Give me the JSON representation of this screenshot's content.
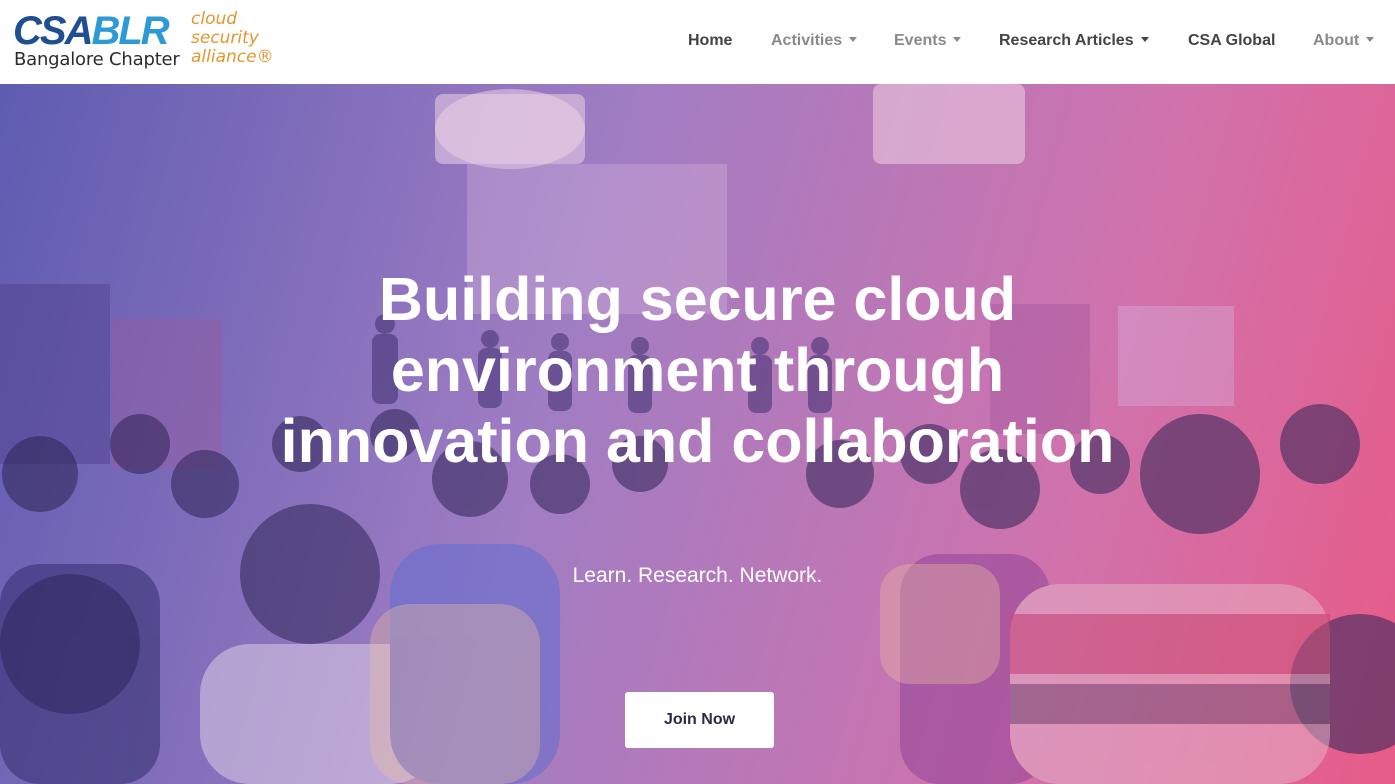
{
  "logo": {
    "csa": "CSA",
    "blr": "BLR",
    "chapter": "Bangalore Chapter",
    "alliance_lines": [
      "cloud",
      "security",
      "alliance®"
    ]
  },
  "nav": {
    "items": [
      {
        "label": "Home",
        "dropdown": false
      },
      {
        "label": "Activities",
        "dropdown": true
      },
      {
        "label": "Events",
        "dropdown": true
      },
      {
        "label": "Research Articles",
        "dropdown": true
      },
      {
        "label": "CSA Global",
        "dropdown": false
      },
      {
        "label": "About",
        "dropdown": true
      }
    ]
  },
  "hero": {
    "heading_lines": [
      "Building secure cloud",
      "environment through",
      "innovation and collaboration"
    ],
    "subheading": "Learn. Research. Network.",
    "cta_label": "Join Now"
  },
  "colors": {
    "csa_blue": "#1e4f93",
    "blr_blue": "#2c9ad6",
    "alliance_orange": "#e3962e",
    "overlay_left": "#3a38a0",
    "overlay_right": "#e2376e"
  }
}
